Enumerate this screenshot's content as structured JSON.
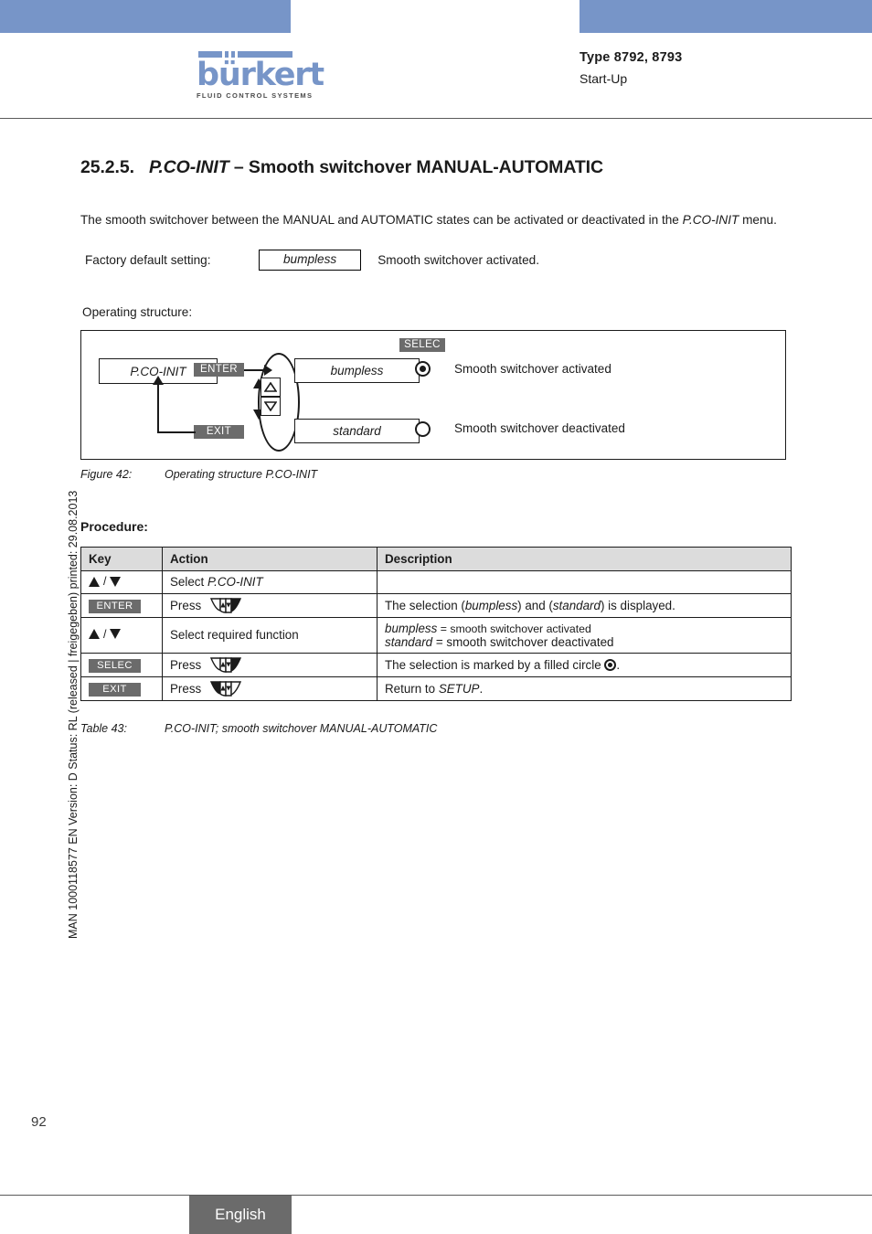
{
  "colors": {
    "brand_blue": "#7795c8",
    "badge_gray": "#6b6b6b",
    "table_header_gray": "#dcdcdc",
    "rule_gray": "#5a5a5a"
  },
  "logo": {
    "wordmark": "bürkert",
    "tagline": "FLUID CONTROL SYSTEMS"
  },
  "header": {
    "type": "Type 8792, 8793",
    "subtitle": "Start-Up"
  },
  "sidebar": {
    "meta": "MAN 1000118577  EN  Version: D  Status: RL (released | freigegeben)  printed: 29.08.2013"
  },
  "section": {
    "number": "25.2.5.",
    "title_italic": "P.CO-INIT",
    "title_rest": "– Smooth switchover MANUAL-AUTOMATIC"
  },
  "intro": {
    "part1": "The smooth switchover between the MANUAL and AUTOMATIC states can be activated or deactivated in the ",
    "italic": "P.CO-INIT",
    "part2": " menu."
  },
  "factory_default": {
    "label": "Factory default setting:",
    "value": "bumpless",
    "description": "Smooth switchover activated."
  },
  "operating_structure": {
    "label": "Operating structure:",
    "menu_box": "P.CO-INIT",
    "enter_tag": "ENTER",
    "exit_tag": "EXIT",
    "selec_tag": "SELEC",
    "option1": "bumpless",
    "option2": "standard",
    "legend1": "Smooth switchover activated",
    "legend1_small": "Sm",
    "legend2": "Smooth switchover deactivated"
  },
  "figure_caption": {
    "label": "Figure 42:",
    "text": "Operating structure P.CO-INIT"
  },
  "procedure": {
    "title": "Procedure:",
    "columns": [
      "Key",
      "Action",
      "Description"
    ],
    "rows": [
      {
        "key_type": "updown",
        "key_label": "",
        "action": "Select P.CO-INIT",
        "action_prefix": "Select ",
        "action_italic": "P.CO-INIT",
        "description": ""
      },
      {
        "key_type": "badge",
        "key_label": "ENTER",
        "action_prefix": "Press",
        "action_italic": "",
        "description": "The selection (bumpless) and (standard) is displayed.",
        "desc_parts": [
          "The selection (",
          "bumpless",
          ") and (",
          "standard",
          ") is displayed."
        ]
      },
      {
        "key_type": "updown",
        "key_label": "",
        "action_prefix": "Select required function",
        "action_italic": "",
        "desc_line1_italic": "bumpless",
        "desc_line1_rest": " = smooth switchover activated",
        "desc_line2_italic": "standard",
        "desc_line2_rest": " = smooth switchover deactivated"
      },
      {
        "key_type": "badge",
        "key_label": "SELEC",
        "action_prefix": "Press",
        "description": "The selection is marked by a filled circle",
        "description_suffix": "."
      },
      {
        "key_type": "badge",
        "key_label": "EXIT",
        "action_prefix": "Press",
        "desc_prefix": "Return to ",
        "desc_italic": "SETUP",
        "desc_suffix": "."
      }
    ]
  },
  "table_caption": {
    "label": "Table 43:",
    "text": "P.CO-INIT; smooth switchover MANUAL-AUTOMATIC"
  },
  "footer": {
    "page_number": "92",
    "language": "English"
  }
}
